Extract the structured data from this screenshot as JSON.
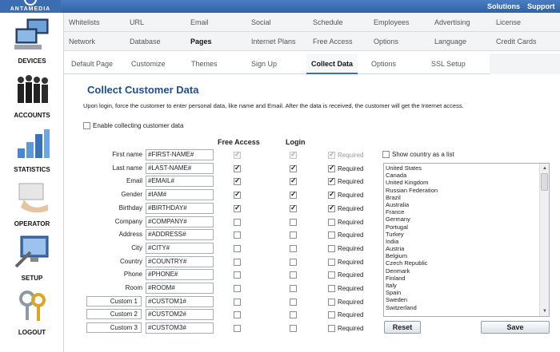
{
  "brand": {
    "name": "ANTAMEDIA"
  },
  "top_links": {
    "solutions": "Solutions",
    "support": "Support"
  },
  "sidebar": {
    "items": [
      {
        "label": "DEVICES",
        "icon": "computer-icon"
      },
      {
        "label": "ACCOUNTS",
        "icon": "people-icon"
      },
      {
        "label": "STATISTICS",
        "icon": "bar-chart-icon"
      },
      {
        "label": "OPERATOR",
        "icon": "card-hand-icon"
      },
      {
        "label": "SETUP",
        "icon": "monitor-tools-icon"
      },
      {
        "label": "LOGOUT",
        "icon": "keys-icon"
      }
    ]
  },
  "tabs_row1": [
    "Whitelists",
    "URL",
    "Email",
    "Social",
    "Schedule",
    "Employees",
    "Advertising",
    "License"
  ],
  "tabs_row2": [
    "Network",
    "Database",
    "Pages",
    "Internet Plans",
    "Free Access",
    "Options",
    "Language",
    "Credit Cards"
  ],
  "tabs_row3": [
    "Default Page",
    "Customize",
    "Themes",
    "Sign Up",
    "Collect Data",
    "Options",
    "SSL Setup"
  ],
  "active_tabs": {
    "row2": "Pages",
    "row3": "Collect Data"
  },
  "page": {
    "title": "Collect Customer Data",
    "description": "Upon login, force the customer to enter personal data, like name and Email. After the data is received, the customer will get the Internet access.",
    "enable_label": "Enable collecting customer data",
    "enable_checked": false,
    "col_free_access": "Free Access",
    "col_login": "Login",
    "required_label": "Required",
    "show_country_label": "Show country as a list",
    "show_country_checked": false
  },
  "fields": [
    {
      "label": "First name",
      "value": "#FIRST-NAME#",
      "custom": false,
      "free": true,
      "login": true,
      "required": true
    },
    {
      "label": "Last name",
      "value": "#LAST-NAME#",
      "custom": false,
      "free": true,
      "login": true,
      "required": true
    },
    {
      "label": "Email",
      "value": "#EMAIL#",
      "custom": false,
      "free": true,
      "login": true,
      "required": true
    },
    {
      "label": "Gender",
      "value": "#IAM#",
      "custom": false,
      "free": true,
      "login": true,
      "required": true
    },
    {
      "label": "Birthday",
      "value": "#BIRTHDAY#",
      "custom": false,
      "free": true,
      "login": true,
      "required": true
    },
    {
      "label": "Company",
      "value": "#COMPANY#",
      "custom": false,
      "free": false,
      "login": false,
      "required": false
    },
    {
      "label": "Address",
      "value": "#ADDRESS#",
      "custom": false,
      "free": false,
      "login": false,
      "required": false
    },
    {
      "label": "City",
      "value": "#CITY#",
      "custom": false,
      "free": false,
      "login": false,
      "required": false
    },
    {
      "label": "Country",
      "value": "#COUNTRY#",
      "custom": false,
      "free": false,
      "login": false,
      "required": false
    },
    {
      "label": "Phone",
      "value": "#PHONE#",
      "custom": false,
      "free": false,
      "login": false,
      "required": false
    },
    {
      "label": "Room",
      "value": "#ROOM#",
      "custom": false,
      "free": false,
      "login": false,
      "required": false
    },
    {
      "label": "Custom 1",
      "value": "#CUSTOM1#",
      "custom": true,
      "free": false,
      "login": false,
      "required": false
    },
    {
      "label": "Custom 2",
      "value": "#CUSTOM2#",
      "custom": true,
      "free": false,
      "login": false,
      "required": false
    },
    {
      "label": "Custom 3",
      "value": "#CUSTOM3#",
      "custom": true,
      "free": false,
      "login": false,
      "required": false
    }
  ],
  "countries": [
    "United States",
    "Canada",
    "United Kingdom",
    "Russian Federation",
    "Brazil",
    "Australia",
    "France",
    "Germany",
    "Portugal",
    "Turkey",
    "India",
    "Austria",
    "Belgium",
    "Czech Republic",
    "Denmark",
    "Finland",
    "Italy",
    "Spain",
    "Sweden",
    "Switzerland"
  ],
  "buttons": {
    "reset": "Reset",
    "save": "Save"
  },
  "colors": {
    "title": "#1b4e94",
    "topbar": "#2f62a8",
    "active_tab_underline": "#3a70b8"
  }
}
